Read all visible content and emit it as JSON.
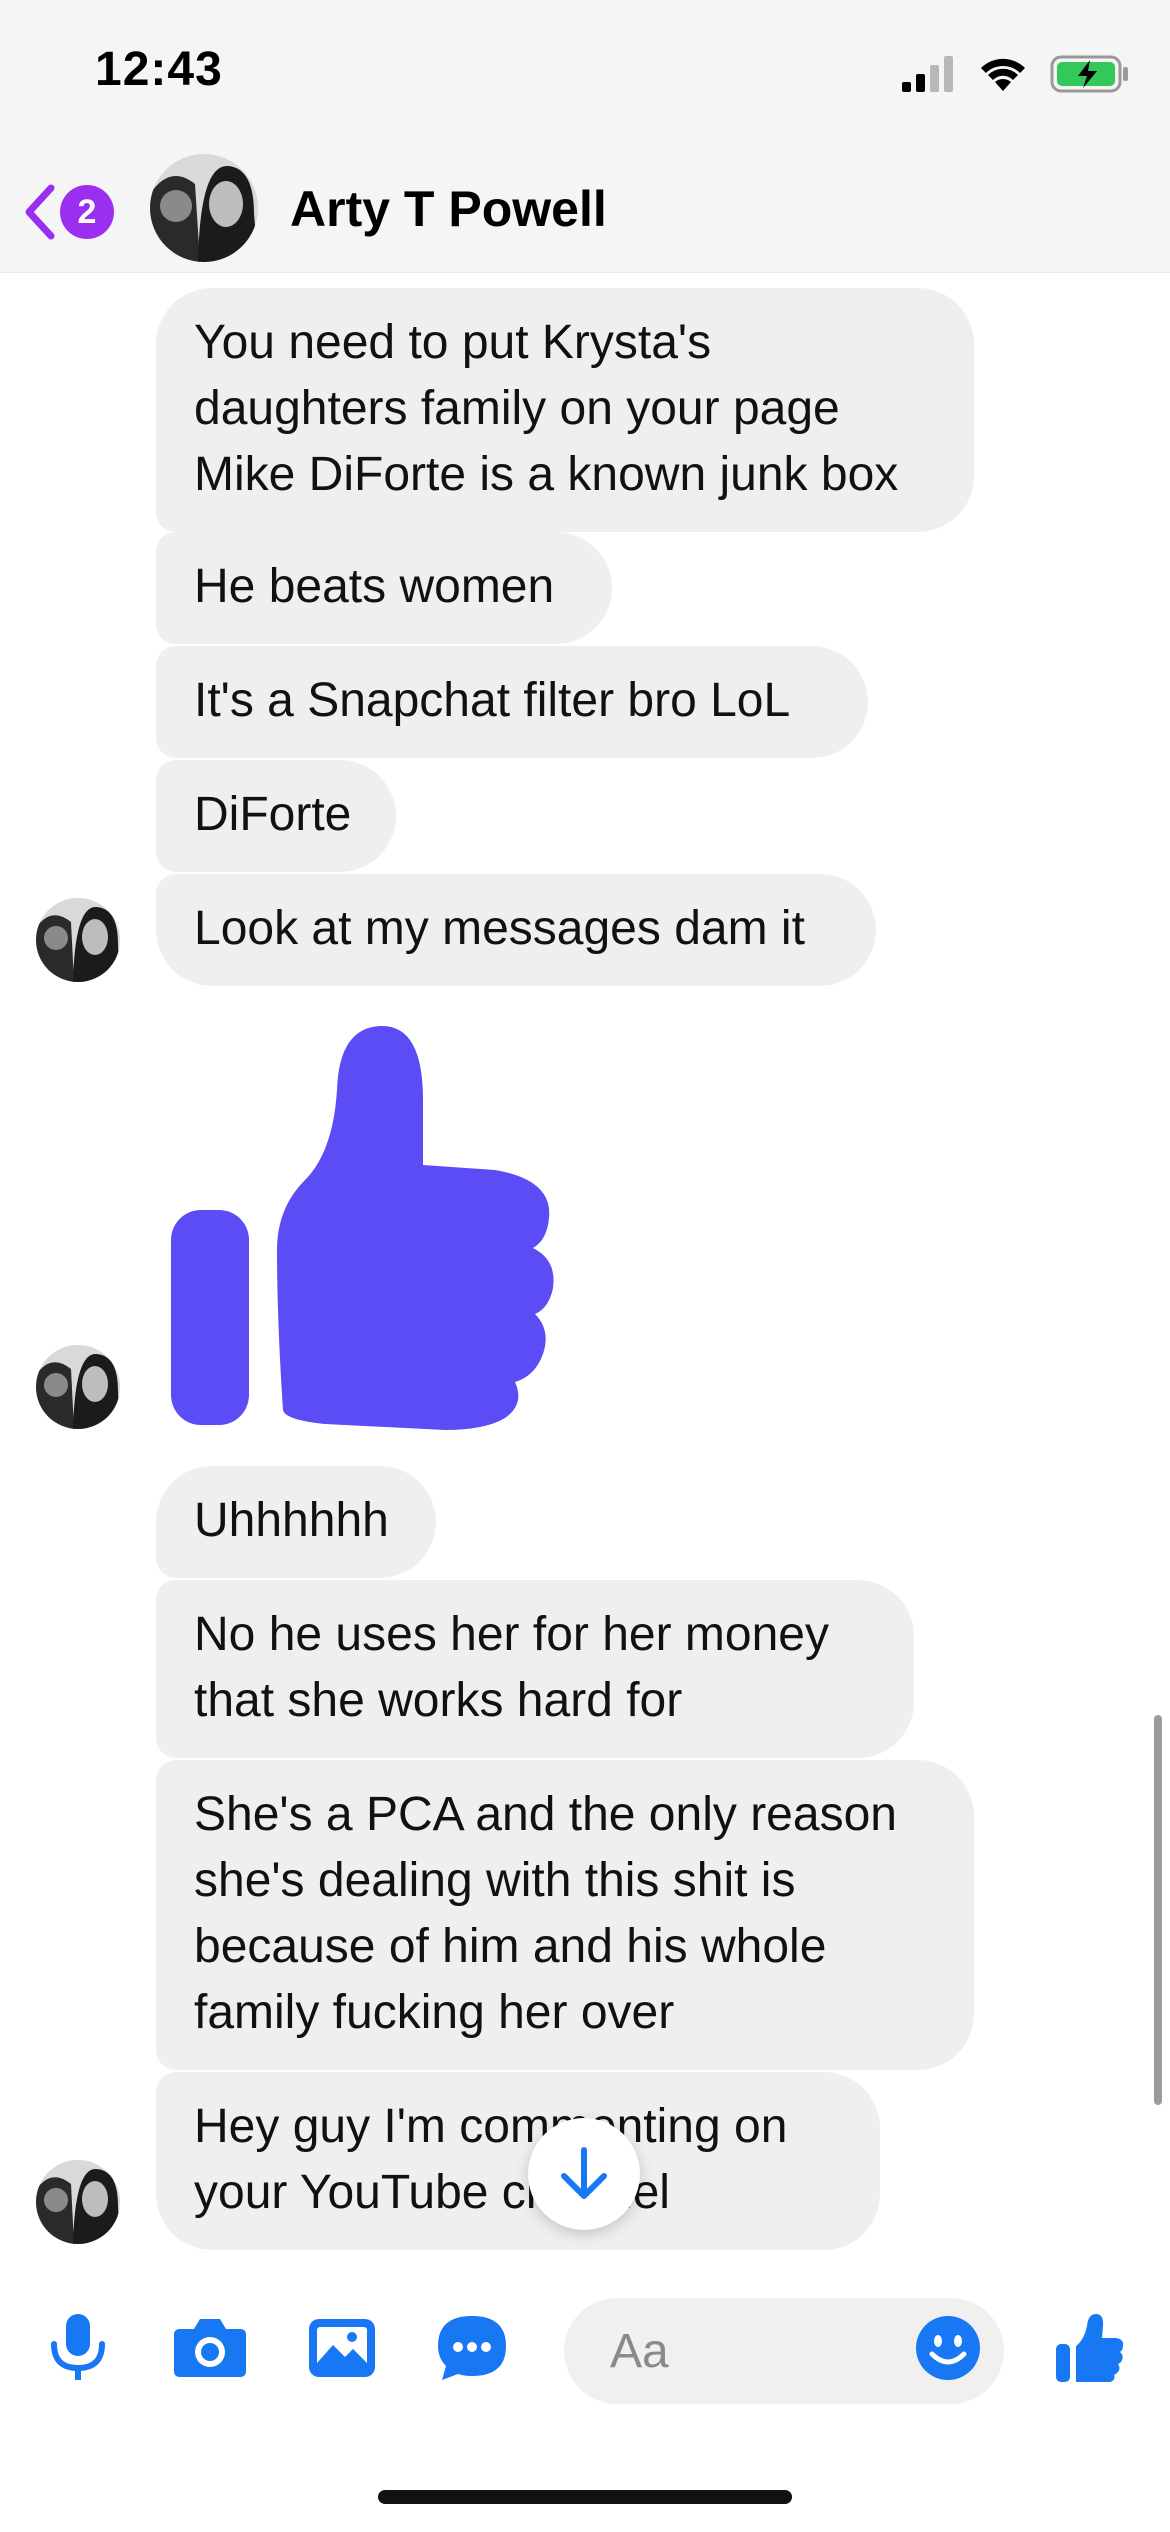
{
  "status_bar": {
    "time": "12:43"
  },
  "header": {
    "back_badge": "2",
    "contact_name": "Arty T Powell"
  },
  "messages": [
    {
      "text": "You need to put Krysta's\ndaughters family on your page\nMike DiForte is a known junk box"
    },
    {
      "text": "He beats women"
    },
    {
      "text": "It's a Snapchat filter bro LoL"
    },
    {
      "text": "DiForte"
    },
    {
      "text": "Look at my messages dam it"
    },
    {
      "text": "Uhhhhhh"
    },
    {
      "text": "No he uses her for her money\nthat she works hard for"
    },
    {
      "text": "She's a PCA and the only reason\nshe's dealing with this shit is\nbecause of him and his whole\nfamily fucking her over"
    },
    {
      "text": "Hey guy I'm commenting on\nyour YouTube channel"
    }
  ],
  "composer": {
    "placeholder": "Aa"
  },
  "colors": {
    "accent": "#1877f2",
    "sticker": "#5b4cf5",
    "badge": "#9b2ff0",
    "bubble": "#efefef"
  },
  "icons": [
    "back-chevron-icon",
    "microphone-icon",
    "camera-icon",
    "gallery-icon",
    "chat-apps-icon",
    "emoji-icon",
    "thumbs-up-icon",
    "scroll-down-arrow-icon"
  ]
}
